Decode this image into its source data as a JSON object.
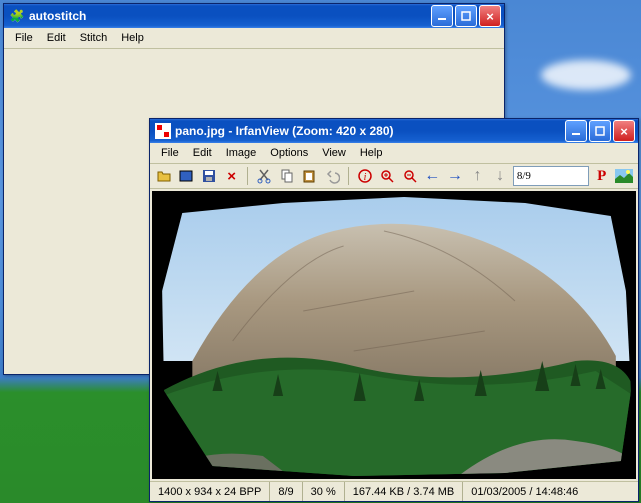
{
  "autostitch": {
    "title": "autostitch",
    "menu": [
      "File",
      "Edit",
      "Stitch",
      "Help"
    ]
  },
  "irfanview": {
    "title": "pano.jpg - IrfanView (Zoom: 420 x 280)",
    "menu": [
      "File",
      "Edit",
      "Image",
      "Options",
      "View",
      "Help"
    ],
    "index_field": "8/9",
    "status": {
      "dims": "1400 x 934 x 24 BPP",
      "index": "8/9",
      "zoom": "30 %",
      "size": "167.44 KB / 3.74 MB",
      "datetime": "01/03/2005 / 14:48:46"
    }
  }
}
